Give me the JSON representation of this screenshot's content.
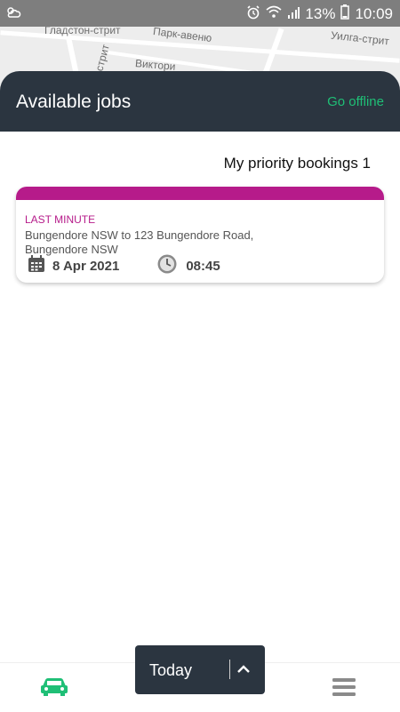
{
  "status_bar": {
    "battery": "13%",
    "time": "10:09"
  },
  "map": {
    "streets": [
      "Гладстон-стрит",
      "Парк-авеню",
      "Уилга-стрит",
      "стрит",
      "Виктори"
    ]
  },
  "header": {
    "title": "Available jobs",
    "offline_label": "Go offline"
  },
  "priority": {
    "text": "My priority bookings 1"
  },
  "job": {
    "tag": "LAST MINUTE",
    "route": "Bungendore NSW to 123 Bungendore Road, Bungendore NSW",
    "date": "8 Apr 2021",
    "time": "08:45"
  },
  "bottom_bar": {
    "today_label": "Today"
  },
  "colors": {
    "header_bg": "#2b3540",
    "accent_green": "#1fbf76",
    "accent_magenta": "#b61b8a"
  }
}
